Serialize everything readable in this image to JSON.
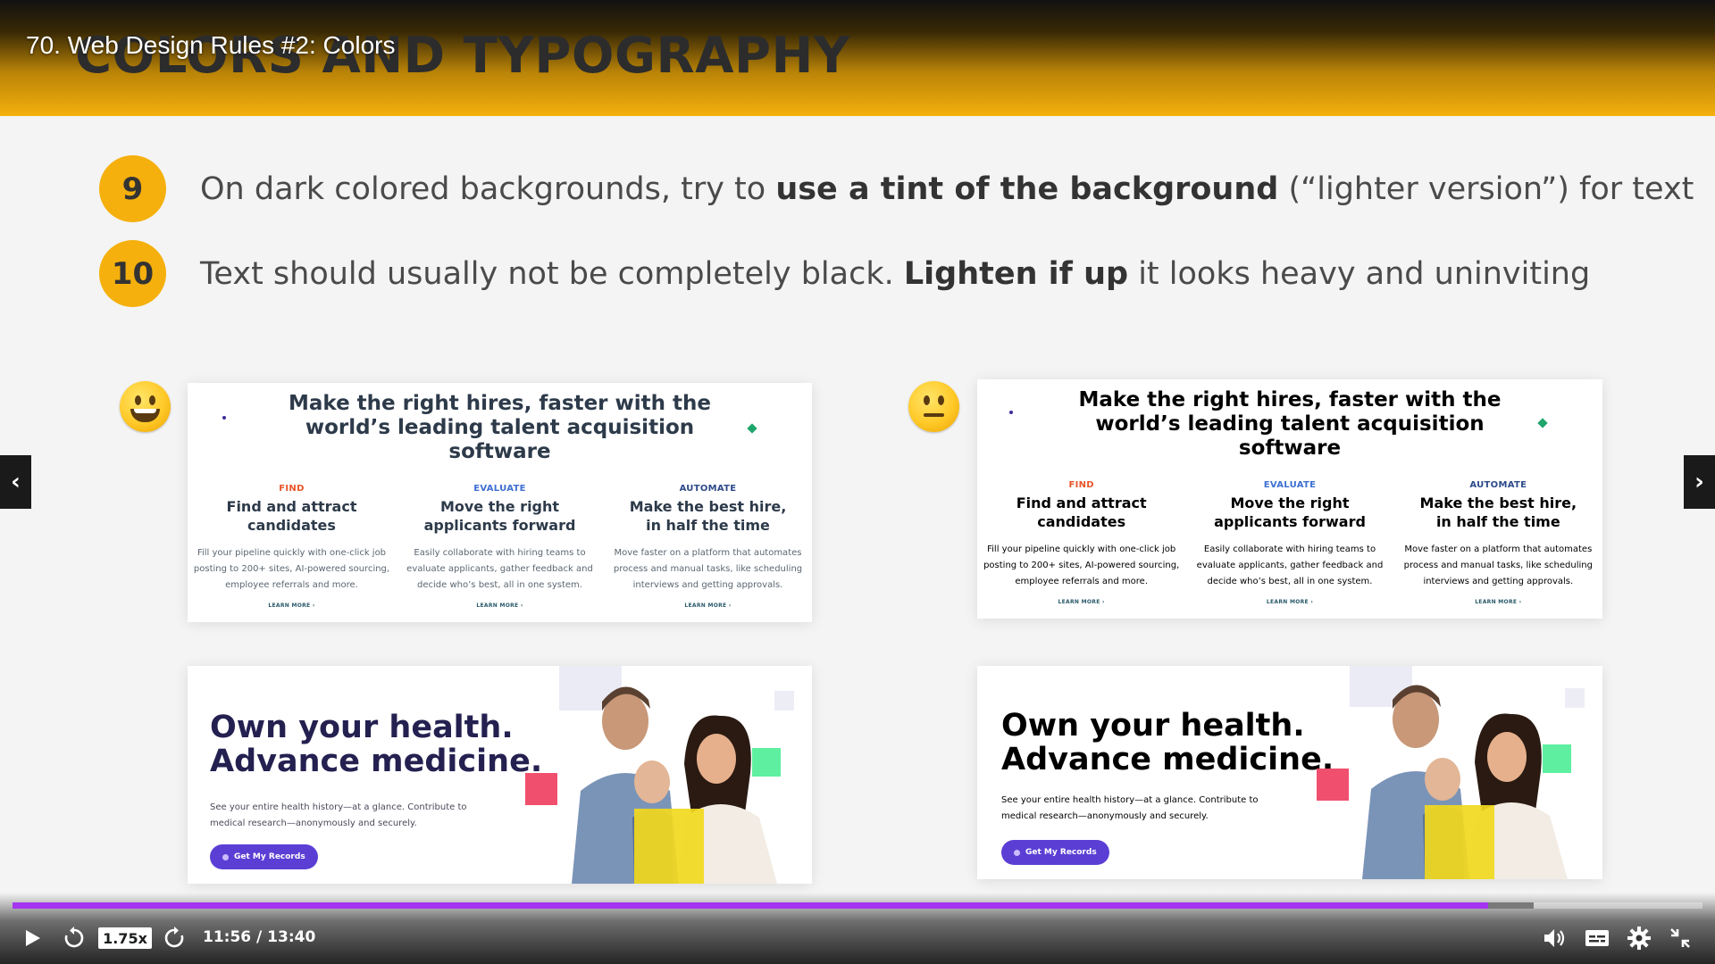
{
  "lecture": {
    "title": "70. Web Design Rules #2: Colors"
  },
  "slide": {
    "heading": "COLORS AND TYPOGRAPHY",
    "rules": [
      {
        "number": "9",
        "text_before": "On dark colored backgrounds, try to ",
        "bold": "use a tint of the background",
        "text_after": " (“lighter version”) for text"
      },
      {
        "number": "10",
        "text_before": "Text should usually not be completely black. ",
        "bold": "Lighten if up",
        "text_after": " it looks heavy and uninviting"
      }
    ],
    "emoji_good": "grinning-face-emoji",
    "emoji_neutral": "neutral-face-emoji",
    "features_example": {
      "heading_lines": [
        "Make the right hires, faster with the",
        "world’s leading talent acquisition",
        "software"
      ],
      "columns": [
        {
          "label": "FIND",
          "title_lines": [
            "Find and attract",
            "candidates"
          ],
          "desc_lines": [
            "Fill your pipeline quickly with one-click job",
            "posting to 200+ sites, AI-powered sourcing,",
            "employee referrals and more."
          ],
          "link": "LEARN MORE  ›"
        },
        {
          "label": "EVALUATE",
          "title_lines": [
            "Move the right",
            "applicants forward"
          ],
          "desc_lines": [
            "Easily collaborate with hiring teams to",
            "evaluate applicants, gather feedback and",
            "decide who’s best, all in one system."
          ],
          "link": "LEARN MORE  ›"
        },
        {
          "label": "AUTOMATE",
          "title_lines": [
            "Make the best hire,",
            "in half the time"
          ],
          "desc_lines": [
            "Move faster on a platform that automates",
            "process and manual tasks, like scheduling",
            "interviews and getting approvals."
          ],
          "link": "LEARN MORE  ›"
        }
      ]
    },
    "health_example": {
      "title_lines": [
        "Own your health.",
        "Advance medicine."
      ],
      "sub_lines": [
        "See your entire health history—at a glance. Contribute to",
        "medical research—anonymously and securely."
      ],
      "button": "Get My Records"
    },
    "colors": {
      "good_heading": "#2d3a4a",
      "good_body": "#5b6672",
      "bad_text": "#000000",
      "find": "#e8552a",
      "evaluate": "#3e6fd1",
      "automate": "#2d4a8a",
      "link": "#2a5a6a",
      "health_good_title": "#242050",
      "health_good_body": "#4a4a5a"
    }
  },
  "player": {
    "speed": "1.75x",
    "time": "11:56 / 13:40",
    "progress": 0.873,
    "buffered": 0.9
  }
}
